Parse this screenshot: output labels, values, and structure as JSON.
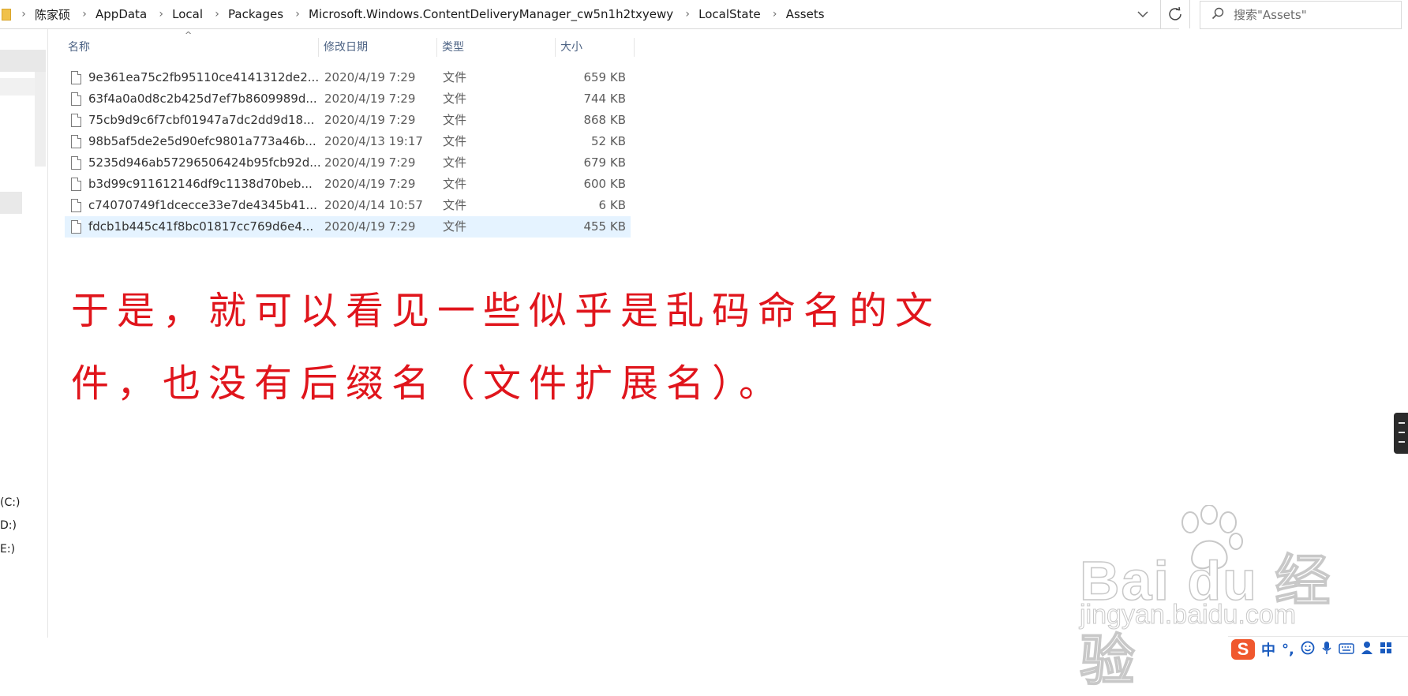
{
  "address_bar": {
    "breadcrumb": [
      "陈家硕",
      "AppData",
      "Local",
      "Packages",
      "Microsoft.Windows.ContentDeliveryManager_cw5n1h2txyewy",
      "LocalState",
      "Assets"
    ],
    "separator": "›",
    "dropdown_icon": "chevron-down-icon",
    "refresh_icon": "refresh-icon"
  },
  "search": {
    "placeholder": "搜索\"Assets\"",
    "icon": "search-icon"
  },
  "nav": {
    "drives": [
      "(C:)",
      "D:)",
      "E:)"
    ]
  },
  "columns": {
    "name": "名称",
    "date": "修改日期",
    "type": "类型",
    "size": "大小"
  },
  "files": [
    {
      "name": "9e361ea75c2fb95110ce4141312de2...",
      "date": "2020/4/19 7:29",
      "type": "文件",
      "size": "659 KB"
    },
    {
      "name": "63f4a0a0d8c2b425d7ef7b8609989d...",
      "date": "2020/4/19 7:29",
      "type": "文件",
      "size": "744 KB"
    },
    {
      "name": "75cb9d9c6f7cbf01947a7dc2dd9d18...",
      "date": "2020/4/19 7:29",
      "type": "文件",
      "size": "868 KB"
    },
    {
      "name": "98b5af5de2e5d90efc9801a773a46b...",
      "date": "2020/4/13 19:17",
      "type": "文件",
      "size": "52 KB"
    },
    {
      "name": "5235d946ab57296506424b95fcb92d...",
      "date": "2020/4/19 7:29",
      "type": "文件",
      "size": "679 KB"
    },
    {
      "name": "b3d99c911612146df9c1138d70beb...",
      "date": "2020/4/19 7:29",
      "type": "文件",
      "size": "600 KB"
    },
    {
      "name": "c74070749f1dcecce33e7de4345b41...",
      "date": "2020/4/14 10:57",
      "type": "文件",
      "size": "6 KB"
    },
    {
      "name": "fdcb1b445c41f8bc01817cc769d6e4...",
      "date": "2020/4/19 7:29",
      "type": "文件",
      "size": "455 KB",
      "selected": true
    }
  ],
  "caption": {
    "line1": "于是，就可以看见一些似乎是乱码命名的文",
    "line2": "件，也没有后缀名（文件扩展名）。",
    "color": "#e0151c"
  },
  "watermark": {
    "logo": "Bai du 经验",
    "url": "jingyan.baidu.com"
  },
  "ime": {
    "logo": "S",
    "mode": "中",
    "punct": "°,",
    "icons": [
      "emoji-icon",
      "microphone-icon",
      "keyboard-icon",
      "user-icon",
      "grid-icon"
    ]
  }
}
